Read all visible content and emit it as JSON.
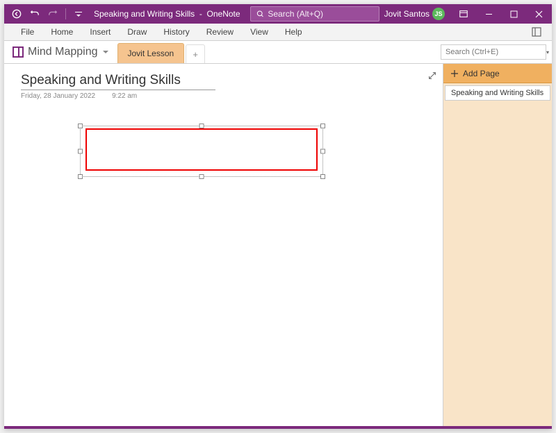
{
  "titlebar": {
    "title_doc": "Speaking and Writing Skills",
    "title_sep": "-",
    "title_app": "OneNote",
    "search_placeholder": "Search (Alt+Q)",
    "user": "Jovit Santos",
    "avatar": "JS"
  },
  "ribbon": {
    "tabs": [
      "File",
      "Home",
      "Insert",
      "Draw",
      "History",
      "Review",
      "View",
      "Help"
    ]
  },
  "notebook": {
    "name": "Mind Mapping",
    "section": "Jovit Lesson",
    "search_placeholder": "Search (Ctrl+E)"
  },
  "page": {
    "title": "Speaking and Writing Skills",
    "date": "Friday, 28 January 2022",
    "time": "9:22 am"
  },
  "pagepanel": {
    "add": "Add Page",
    "items": [
      "Speaking and Writing Skills"
    ]
  }
}
